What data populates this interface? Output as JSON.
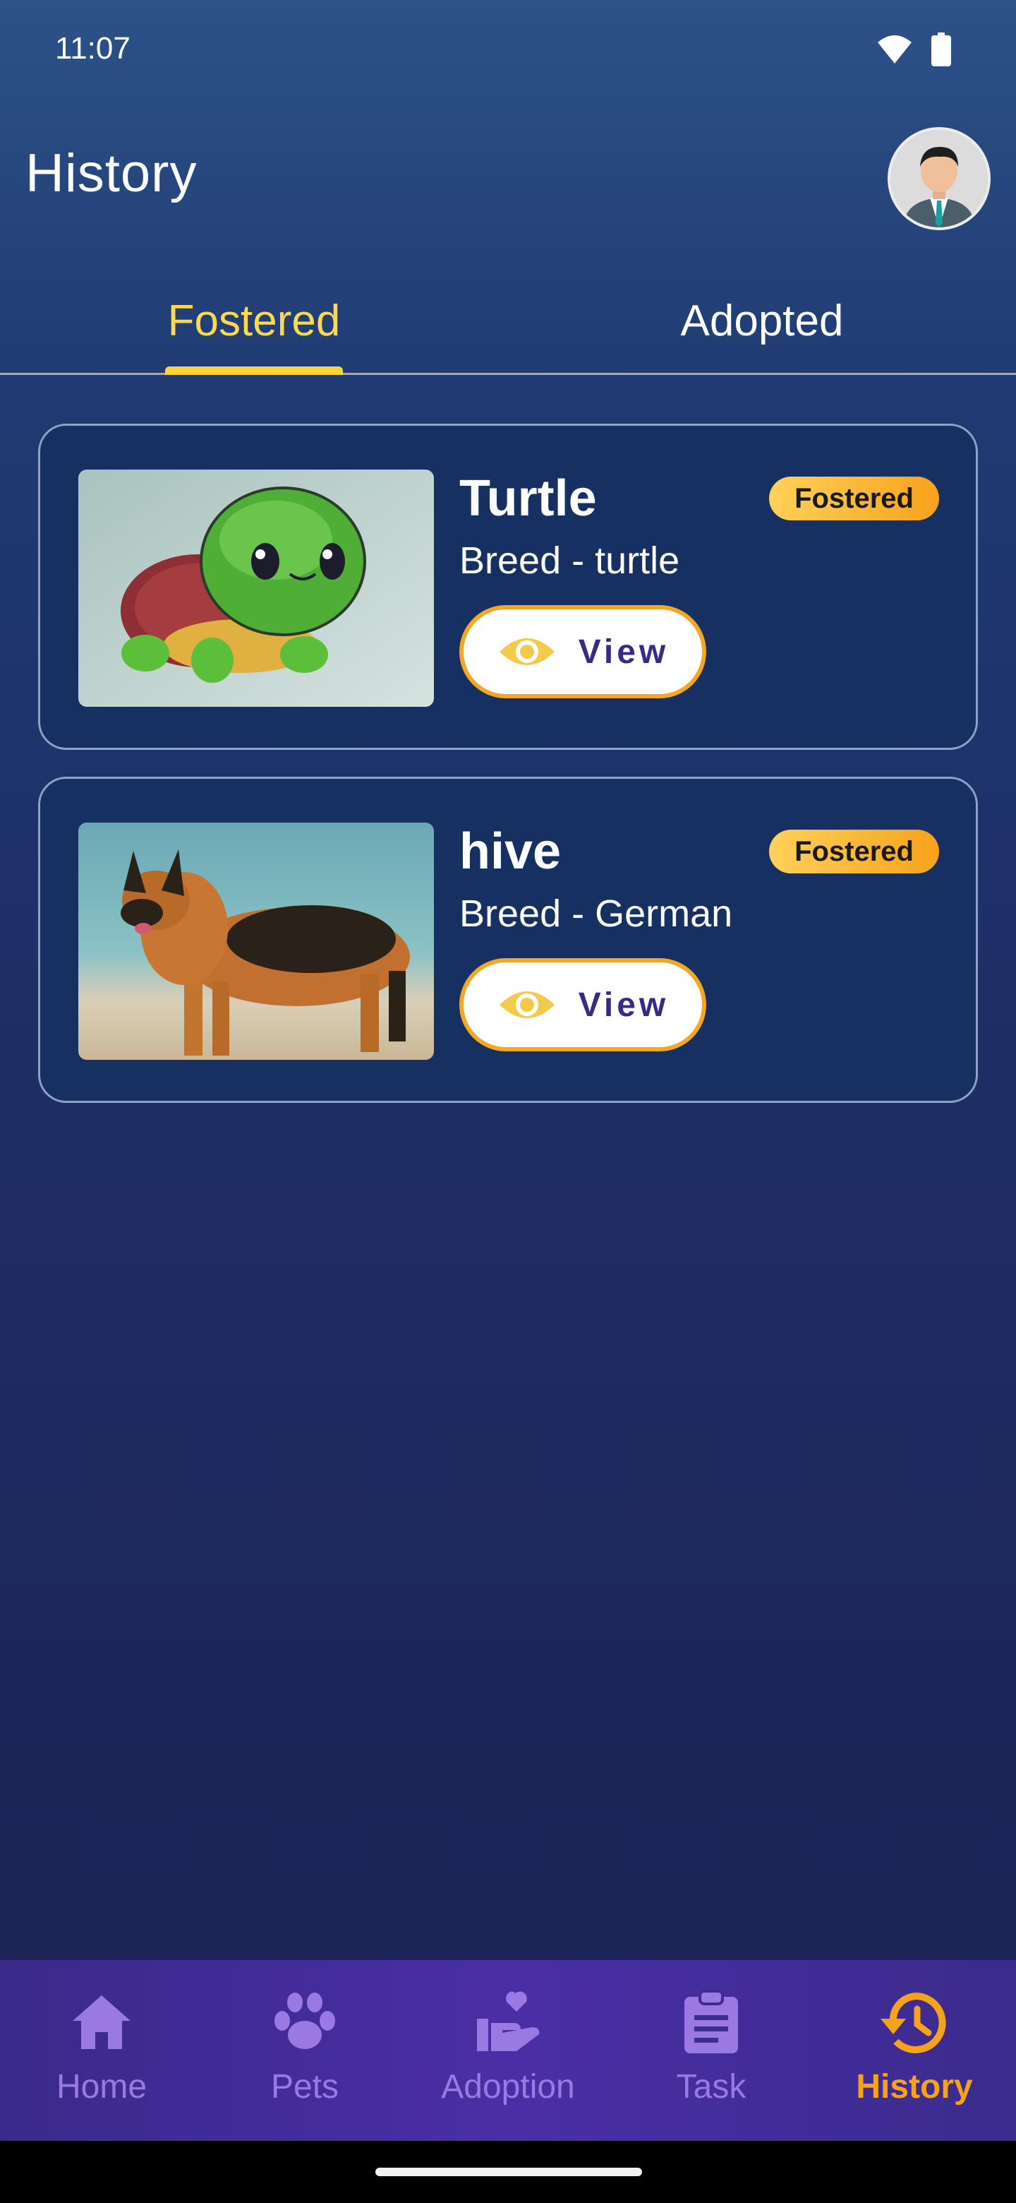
{
  "status_bar": {
    "time": "11:07",
    "icons": [
      "wifi-icon",
      "battery-icon"
    ]
  },
  "header": {
    "title": "History",
    "avatar": "profile-avatar"
  },
  "tabs": [
    {
      "label": "Fostered",
      "active": true
    },
    {
      "label": "Adopted",
      "active": false
    }
  ],
  "pets": [
    {
      "name": "Turtle",
      "breed": "Breed - turtle",
      "status": "Fostered",
      "view_label": "View",
      "image": "turtle-photo"
    },
    {
      "name": "hive",
      "breed": "Breed - German",
      "status": "Fostered",
      "view_label": "View",
      "image": "german-shepherd-photo"
    }
  ],
  "bottom_nav": [
    {
      "label": "Home",
      "icon": "home-icon",
      "active": false
    },
    {
      "label": "Pets",
      "icon": "paw-icon",
      "active": false
    },
    {
      "label": "Adoption",
      "icon": "adoption-hand-heart-icon",
      "active": false
    },
    {
      "label": "Task",
      "icon": "clipboard-icon",
      "active": false
    },
    {
      "label": "History",
      "icon": "history-icon",
      "active": true
    }
  ],
  "colors": {
    "accent_yellow": "#ffd84d",
    "accent_orange": "#f7a21b",
    "nav_inactive": "#9a79e3",
    "card_bg": "#173062"
  }
}
